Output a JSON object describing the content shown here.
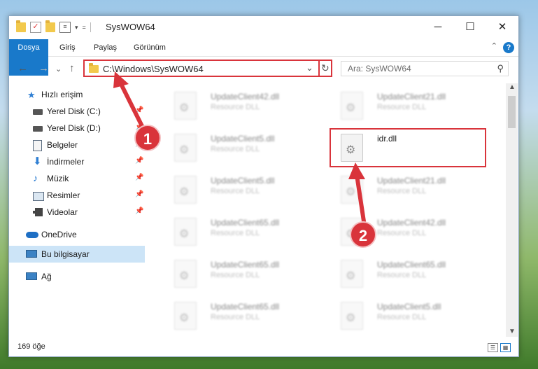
{
  "window": {
    "title": "SysWOW64",
    "minimize_glyph": "─",
    "maximize_glyph": "☐",
    "close_glyph": "✕"
  },
  "qat": {
    "dropdown_glyph": "▾",
    "customize_glyph": "="
  },
  "ribbon": {
    "tabs": [
      "Dosya",
      "Giriş",
      "Paylaş",
      "Görünüm"
    ],
    "help_label": "?",
    "collapse_glyph": "⌃"
  },
  "nav": {
    "back_glyph": "←",
    "forward_glyph": "→",
    "recent_glyph": "⌄",
    "up_glyph": "↑"
  },
  "address": {
    "path": "C:\\Windows\\SysWOW64",
    "dropdown_glyph": "⌄",
    "refresh_glyph": "↻"
  },
  "search": {
    "placeholder": "Ara: SysWOW64",
    "icon_glyph": "⚲"
  },
  "sidebar": {
    "pin_glyph": "📌",
    "items": [
      {
        "label": "Hızlı erişim",
        "icon": "star-icon",
        "color": "#2f7fd3"
      },
      {
        "label": "Yerel Disk (C:)",
        "icon": "drive-icon",
        "color": "#555555"
      },
      {
        "label": "Yerel Disk (D:)",
        "icon": "drive-icon",
        "color": "#555555"
      },
      {
        "label": "Belgeler",
        "icon": "documents-icon",
        "color": "#5a6c80"
      },
      {
        "label": "İndirmeler",
        "icon": "downloads-icon",
        "color": "#2f7fd3"
      },
      {
        "label": "Müzik",
        "icon": "music-icon",
        "color": "#2f7fd3"
      },
      {
        "label": "Resimler",
        "icon": "pictures-icon",
        "color": "#5a6c80"
      },
      {
        "label": "Videolar",
        "icon": "videos-icon",
        "color": "#444444"
      },
      {
        "label": "OneDrive",
        "icon": "cloud-icon",
        "color": "#1e6fc4"
      },
      {
        "label": "Bu bilgisayar",
        "icon": "computer-icon",
        "color": "#3b82c4"
      },
      {
        "label": "Ağ",
        "icon": "network-icon",
        "color": "#3b82c4"
      }
    ]
  },
  "files": {
    "gear_glyph": "⚙",
    "items": [
      {
        "name": "UpdateClient42.dll",
        "type": "Resource DLL"
      },
      {
        "name": "UpdateClient21.dll",
        "type": "Resource DLL"
      },
      {
        "name": "UpdateClient5.dll",
        "type": "Resource DLL"
      },
      {
        "name": "idr.dll",
        "type": ""
      },
      {
        "name": "UpdateClient5.dll",
        "type": "Resource DLL"
      },
      {
        "name": "UpdateClient21.dll",
        "type": "Resource DLL"
      },
      {
        "name": "UpdateClient65.dll",
        "type": "Resource DLL"
      },
      {
        "name": "UpdateClient42.dll",
        "type": "Resource DLL"
      },
      {
        "name": "UpdateClient65.dll",
        "type": "Resource DLL"
      },
      {
        "name": "UpdateClient65.dll",
        "type": "Resource DLL"
      },
      {
        "name": "UpdateClient65.dll",
        "type": "Resource DLL"
      },
      {
        "name": "UpdateClient5.dll",
        "type": "Resource DLL"
      }
    ]
  },
  "scrollbar": {
    "up_glyph": "▲",
    "down_glyph": "▼"
  },
  "status": {
    "item_count": "169 öğe",
    "details_view_glyph": "☰",
    "icons_view_glyph": "▦"
  },
  "annotations": {
    "badge1": "1",
    "badge2": "2",
    "color": "#d9343b"
  }
}
